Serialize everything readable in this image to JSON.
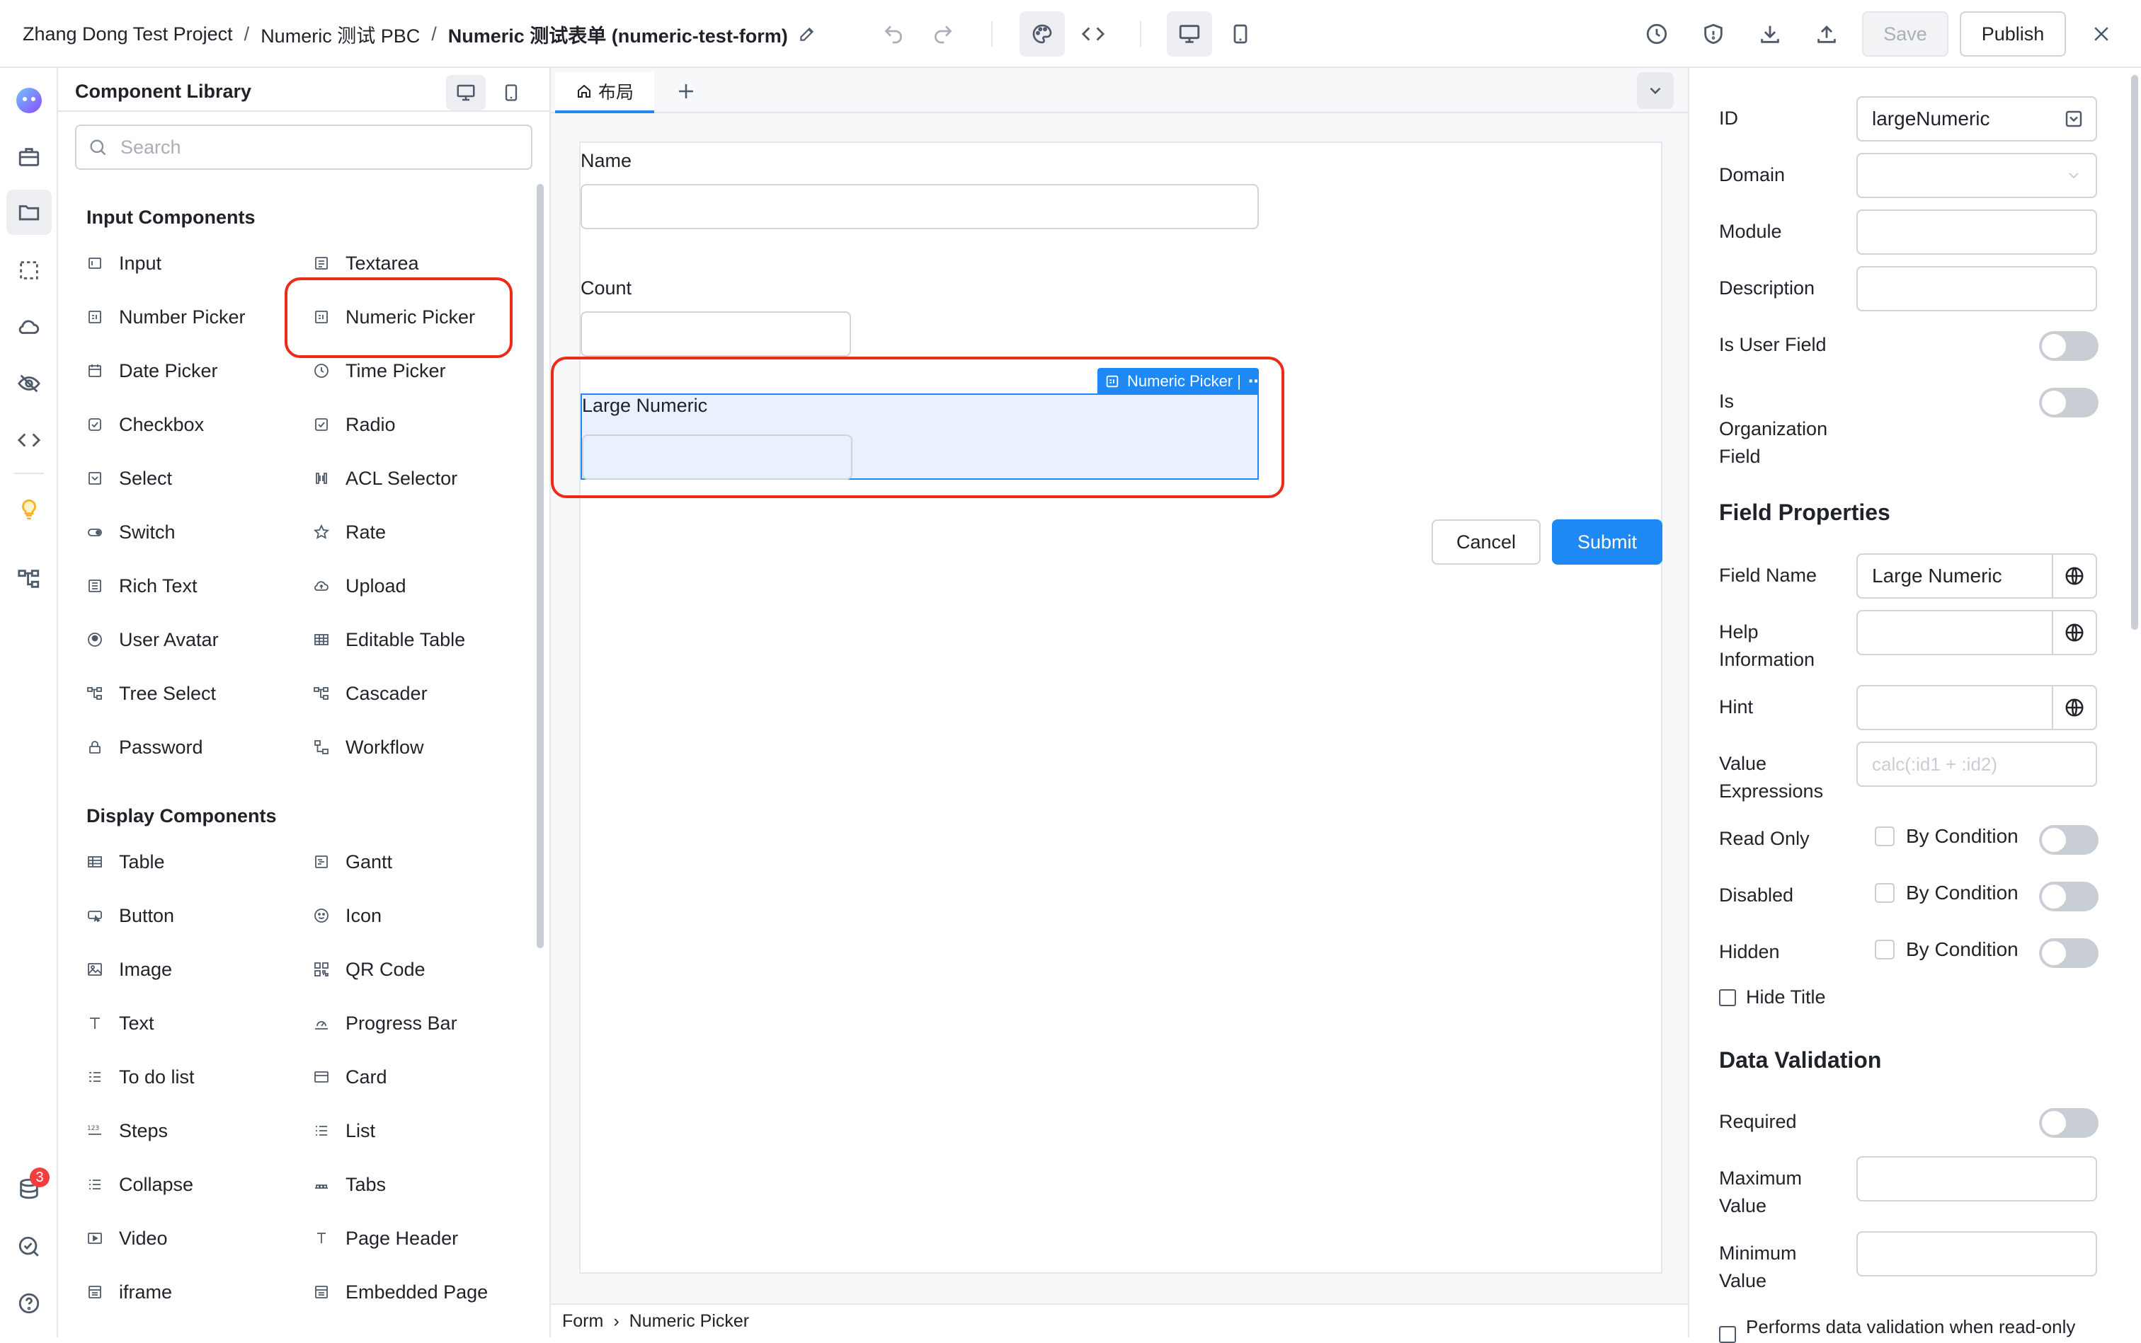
{
  "breadcrumb": {
    "project": "Zhang Dong Test Project",
    "sep1": "/",
    "app": "Numeric 测试 PBC",
    "sep2": "/",
    "form": "Numeric 测试表单 (numeric-test-form)"
  },
  "toolbar": {
    "save_label": "Save",
    "publish_label": "Publish",
    "icons": [
      "undo-icon",
      "redo-icon",
      "palette-icon",
      "code-icon",
      "desktop-icon",
      "mobile-icon",
      "history-icon",
      "shield-icon",
      "download-icon",
      "upload-icon",
      "close-icon"
    ]
  },
  "rail": {
    "icons": [
      "logo-icon",
      "briefcase-icon",
      "folder-icon",
      "selection-icon",
      "cloud-icon",
      "eye-off-icon",
      "code-icon",
      "bulb-icon",
      "tree-icon",
      "database-icon",
      "search-check-icon",
      "help-icon"
    ],
    "notification_count": "3"
  },
  "library": {
    "title": "Component Library",
    "search_placeholder": "Search",
    "input_section": "Input Components",
    "input_items": [
      {
        "label": "Input"
      },
      {
        "label": "Textarea"
      },
      {
        "label": "Number Picker"
      },
      {
        "label": "Numeric Picker"
      },
      {
        "label": "Date Picker"
      },
      {
        "label": "Time Picker"
      },
      {
        "label": "Checkbox"
      },
      {
        "label": "Radio"
      },
      {
        "label": "Select"
      },
      {
        "label": "ACL Selector"
      },
      {
        "label": "Switch"
      },
      {
        "label": "Rate"
      },
      {
        "label": "Rich Text"
      },
      {
        "label": "Upload"
      },
      {
        "label": "User Avatar"
      },
      {
        "label": "Editable Table"
      },
      {
        "label": "Tree Select"
      },
      {
        "label": "Cascader"
      },
      {
        "label": "Password"
      },
      {
        "label": "Workflow"
      }
    ],
    "display_section": "Display Components",
    "display_items": [
      {
        "label": "Table"
      },
      {
        "label": "Gantt"
      },
      {
        "label": "Button"
      },
      {
        "label": "Icon"
      },
      {
        "label": "Image"
      },
      {
        "label": "QR Code"
      },
      {
        "label": "Text"
      },
      {
        "label": "Progress Bar"
      },
      {
        "label": "To do list"
      },
      {
        "label": "Card"
      },
      {
        "label": "Steps"
      },
      {
        "label": "List"
      },
      {
        "label": "Collapse"
      },
      {
        "label": "Tabs"
      },
      {
        "label": "Video"
      },
      {
        "label": "Page Header"
      },
      {
        "label": "iframe"
      },
      {
        "label": "Embedded Page"
      }
    ]
  },
  "canvas": {
    "tab_label": "布局",
    "fields": {
      "name_label": "Name",
      "count_label": "Count",
      "large_label": "Large Numeric"
    },
    "selection_tag": "Numeric Picker |",
    "cancel_label": "Cancel",
    "submit_label": "Submit",
    "footer": {
      "root": "Form",
      "sep": "›",
      "current": "Numeric Picker"
    }
  },
  "properties": {
    "id_label": "ID",
    "id_value": "largeNumeric",
    "domain_label": "Domain",
    "module_label": "Module",
    "description_label": "Description",
    "is_user_field_label": "Is User Field",
    "is_org_field_label": [
      "Is",
      "Organization",
      "Field"
    ],
    "field_properties_heading": "Field Properties",
    "field_name_label": "Field Name",
    "field_name_value": "Large Numeric",
    "help_label": [
      "Help",
      "Information"
    ],
    "hint_label": "Hint",
    "value_expr_label": [
      "Value",
      "Expressions"
    ],
    "value_expr_placeholder": "calc(:id1 + :id2)",
    "read_only_label": "Read Only",
    "disabled_label": "Disabled",
    "hidden_label": "Hidden",
    "by_condition_label": "By Condition",
    "hide_title_label": "Hide Title",
    "data_validation_heading": "Data Validation",
    "required_label": "Required",
    "max_value_label": [
      "Maximum",
      "Value"
    ],
    "min_value_label": [
      "Minimum",
      "Value"
    ],
    "readonly_validation_label": "Performs data validation when read-only",
    "toggles": {
      "is_user_field": false,
      "is_org_field": false,
      "read_only": false,
      "disabled": false,
      "hidden": false,
      "required": false
    }
  },
  "colors": {
    "accent": "#1e88f5",
    "highlight": "#ee2a16",
    "selection_bg": "#e8f1fd"
  }
}
